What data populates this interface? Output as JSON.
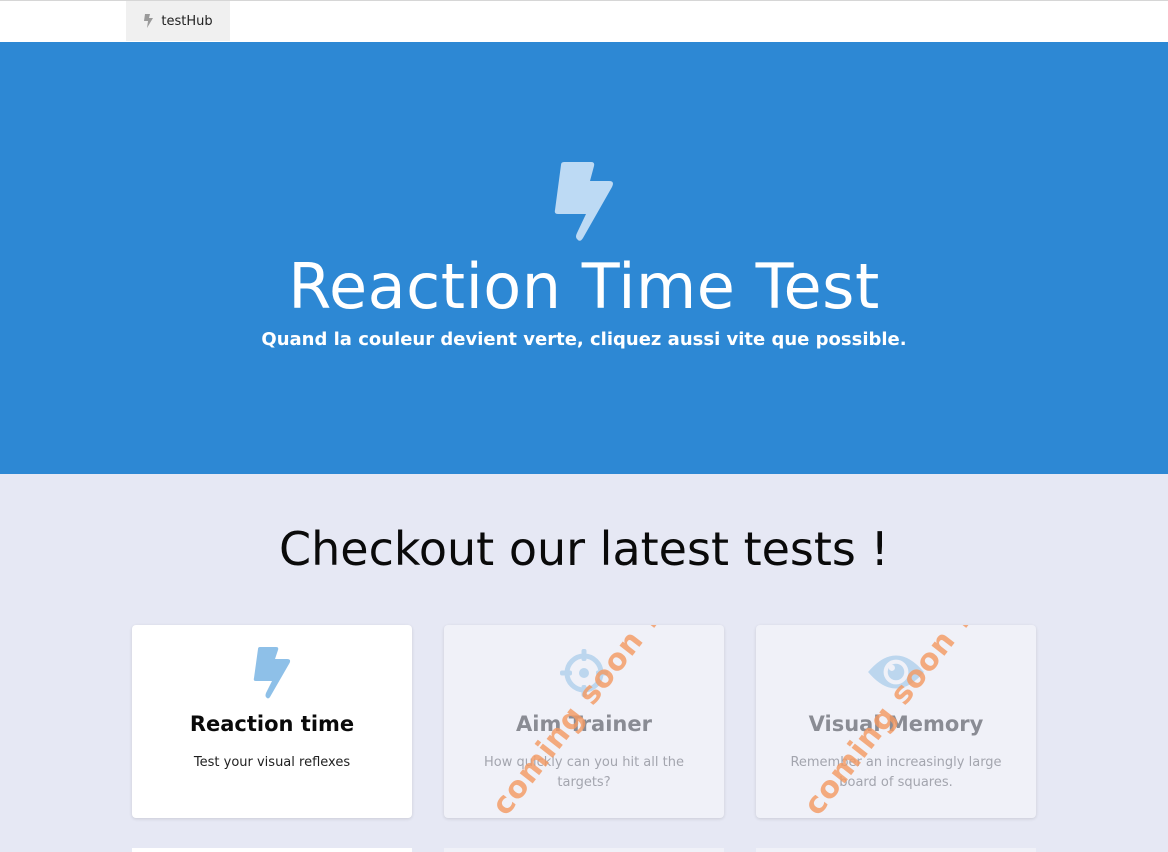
{
  "navbar": {
    "brand_label": "testHub",
    "brand_icon": "lightning-icon"
  },
  "hero": {
    "icon": "lightning-icon",
    "title": "Reaction Time Test",
    "subtitle": "Quand la couleur devient verte, cliquez aussi vite que possible.",
    "background": "#2d88d4"
  },
  "section": {
    "title": "Checkout our latest tests !"
  },
  "cards": [
    {
      "icon": "lightning-icon",
      "title": "Reaction time",
      "description": "Test your visual reflexes",
      "enabled": true
    },
    {
      "icon": "crosshair-icon",
      "title": "Aim Trainer",
      "description": "How quickly can you hit all the targets?",
      "enabled": false,
      "ribbon": "coming soon !"
    },
    {
      "icon": "eye-icon",
      "title": "Visual Memory",
      "description": "Remember an increasingly large board of squares.",
      "enabled": false,
      "ribbon": "coming soon !"
    }
  ],
  "colors": {
    "accent": "#2d88d4",
    "page_background": "#e6e8f4",
    "coming_soon": "#f39a63"
  }
}
